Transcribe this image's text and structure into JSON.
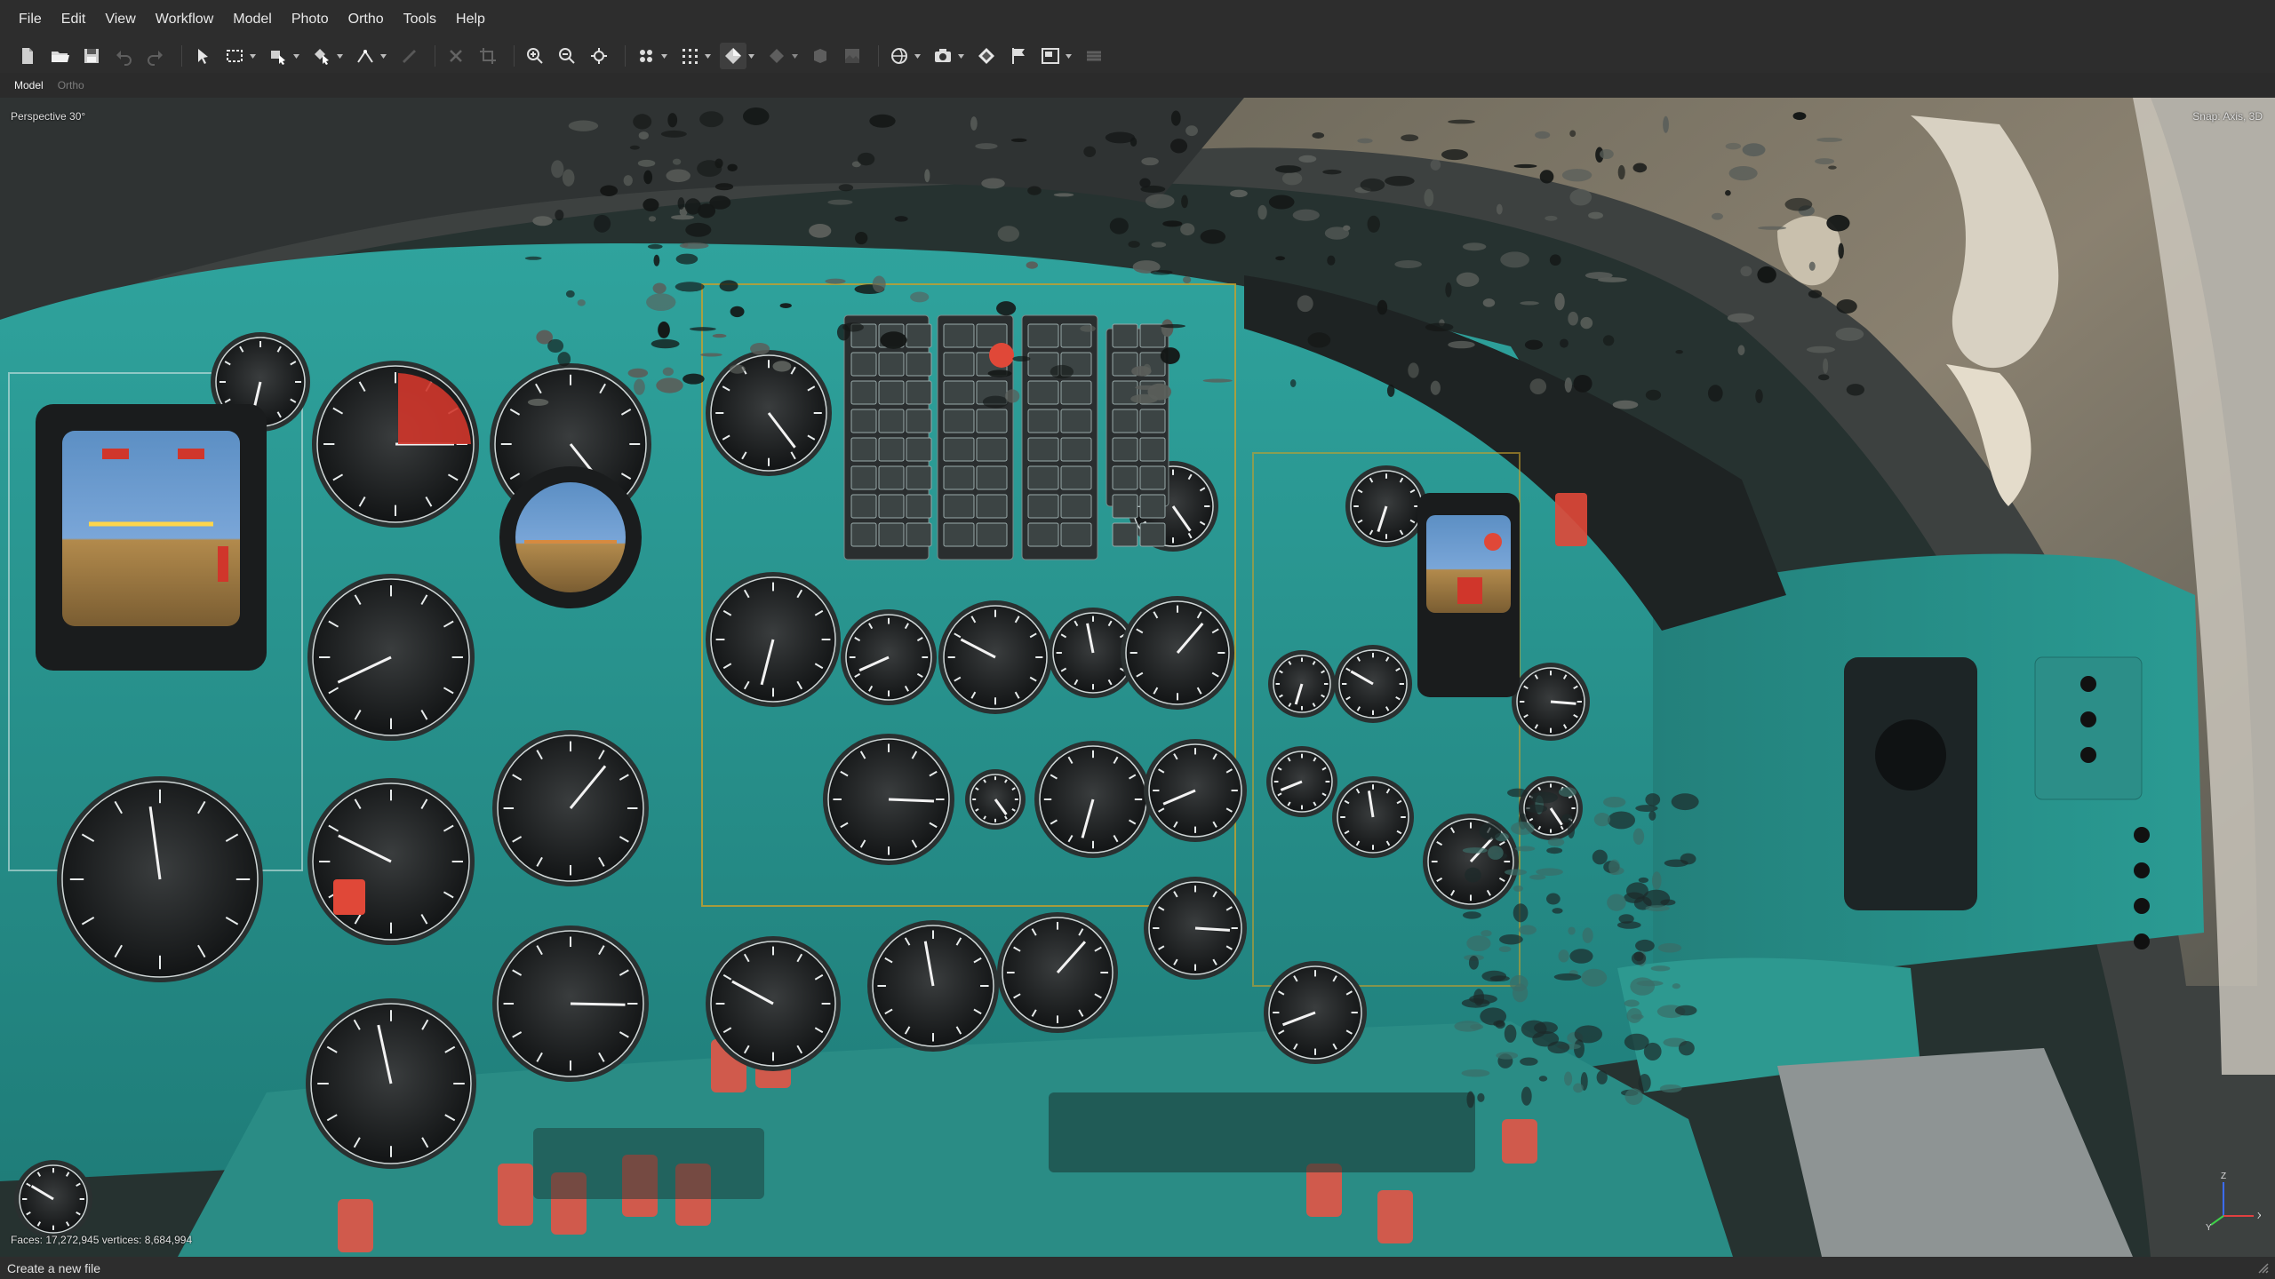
{
  "menu": {
    "items": [
      {
        "label": "File"
      },
      {
        "label": "Edit"
      },
      {
        "label": "View"
      },
      {
        "label": "Workflow"
      },
      {
        "label": "Model"
      },
      {
        "label": "Photo"
      },
      {
        "label": "Ortho"
      },
      {
        "label": "Tools"
      },
      {
        "label": "Help"
      }
    ]
  },
  "toolbar": {
    "buttons": [
      "new-document-icon",
      "open-folder-icon",
      "save-icon",
      "undo-icon",
      "redo-icon",
      "navigation-cursor-icon",
      "rectangle-selection-icon",
      "model-selection-icon",
      "shape-selection-icon",
      "draw-line-icon",
      "ruler-icon",
      "delete-selection-icon",
      "crop-icon",
      "zoom-in-icon",
      "zoom-out-icon",
      "reset-view-icon",
      "show-cameras-icon",
      "show-points-icon",
      "show-model-icon",
      "show-dem-icon",
      "show-tiled-model-icon",
      "show-texture-icon",
      "show-dense-cloud-icon",
      "camera-icon",
      "show-markers-icon",
      "show-flags-icon",
      "show-images-icon",
      "show-layers-icon"
    ]
  },
  "tabs": {
    "model": "Model",
    "ortho": "Ortho"
  },
  "viewport": {
    "projection": "Perspective 30°",
    "snap": "Snap: Axis, 3D",
    "stats": "Faces: 17,272,945 vertices: 8,684,994",
    "axes": {
      "x": "X",
      "y": "Y",
      "z": "Z"
    }
  },
  "status": {
    "message": "Create a new file"
  },
  "colors": {
    "panel": "#2d2d2d",
    "teal_panel": "#2e9a94",
    "gauge_face": "#1b1d1e",
    "warning_red": "#d0362b"
  }
}
